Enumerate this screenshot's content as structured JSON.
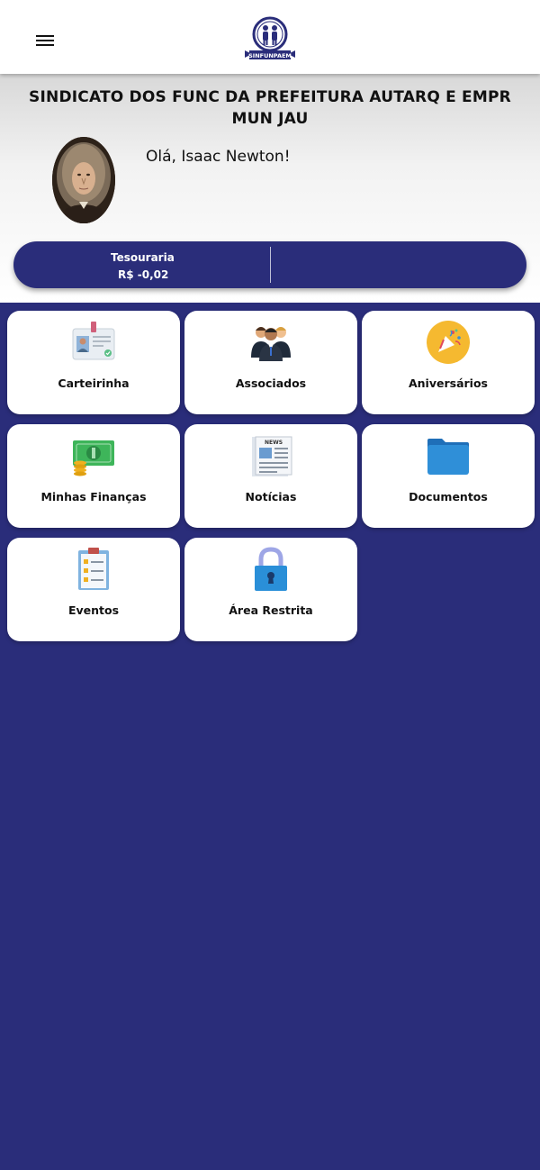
{
  "header": {
    "menu_icon": "hamburger-menu-icon",
    "logo_text": "SINFUNPAEM"
  },
  "org": {
    "title": "SINDICATO DOS FUNC DA PREFEITURA AUTARQ E EMPR MUN JAU"
  },
  "user": {
    "greeting": "Olá, Isaac Newton!"
  },
  "treasury": {
    "label": "Tesouraria",
    "value": "R$ -0,02"
  },
  "menu": [
    {
      "label": "Carteirinha",
      "icon": "id-card-icon"
    },
    {
      "label": "Associados",
      "icon": "people-icon"
    },
    {
      "label": "Aniversários",
      "icon": "party-popper-icon"
    },
    {
      "label": "Minhas Finanças",
      "icon": "money-icon"
    },
    {
      "label": "Notícias",
      "icon": "newspaper-icon"
    },
    {
      "label": "Documentos",
      "icon": "folder-icon"
    },
    {
      "label": "Eventos",
      "icon": "checklist-icon"
    },
    {
      "label": "Área Restrita",
      "icon": "lock-icon"
    }
  ],
  "colors": {
    "primary": "#2a2d7a",
    "card": "#ffffff"
  }
}
